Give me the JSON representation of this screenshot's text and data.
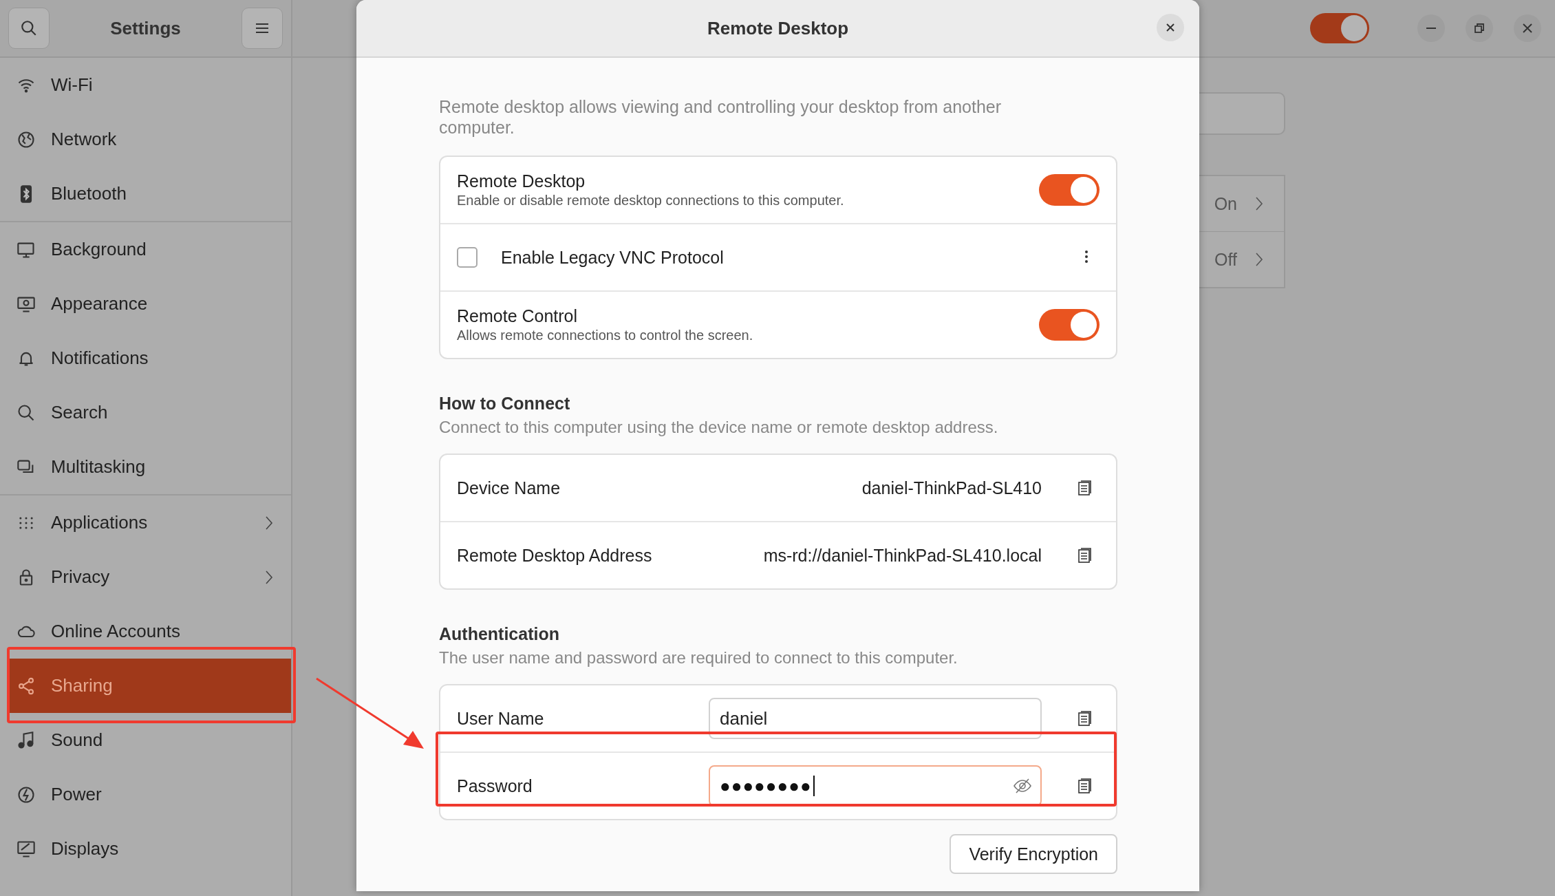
{
  "settings_window": {
    "title": "Settings",
    "sidebar": {
      "groups": [
        [
          {
            "label": "Wi-Fi",
            "selected": false,
            "has_submenu": false
          },
          {
            "label": "Network",
            "selected": false,
            "has_submenu": false
          },
          {
            "label": "Bluetooth",
            "selected": false,
            "has_submenu": false
          }
        ],
        [
          {
            "label": "Background",
            "selected": false,
            "has_submenu": false
          },
          {
            "label": "Appearance",
            "selected": false,
            "has_submenu": false
          },
          {
            "label": "Notifications",
            "selected": false,
            "has_submenu": false
          },
          {
            "label": "Search",
            "selected": false,
            "has_submenu": false
          },
          {
            "label": "Multitasking",
            "selected": false,
            "has_submenu": false
          }
        ],
        [
          {
            "label": "Applications",
            "selected": false,
            "has_submenu": true
          },
          {
            "label": "Privacy",
            "selected": false,
            "has_submenu": true
          },
          {
            "label": "Online Accounts",
            "selected": false,
            "has_submenu": false
          },
          {
            "label": "Sharing",
            "selected": true,
            "has_submenu": false
          },
          {
            "label": "Sound",
            "selected": false,
            "has_submenu": false
          },
          {
            "label": "Power",
            "selected": false,
            "has_submenu": false
          },
          {
            "label": "Displays",
            "selected": false,
            "has_submenu": false
          }
        ]
      ]
    },
    "header_switch": {
      "on": true
    },
    "background_rows": [
      {
        "value": "On"
      },
      {
        "value": "Off"
      }
    ]
  },
  "dialog": {
    "title": "Remote Desktop",
    "intro": "Remote desktop allows viewing and controlling your desktop from another computer.",
    "options": [
      {
        "kind": "switch",
        "title": "Remote Desktop",
        "subtitle": "Enable or disable remote desktop connections to this computer.",
        "on": true
      },
      {
        "kind": "checkbox",
        "title": "Enable Legacy VNC Protocol",
        "checked": false
      },
      {
        "kind": "switch",
        "title": "Remote Control",
        "subtitle": "Allows remote connections to control the screen.",
        "on": true
      }
    ],
    "how_to_connect": {
      "heading": "How to Connect",
      "description": "Connect to this computer using the device name or remote desktop address.",
      "rows": [
        {
          "label": "Device Name",
          "value": "daniel-ThinkPad-SL410"
        },
        {
          "label": "Remote Desktop Address",
          "value": "ms-rd://daniel-ThinkPad-SL410.local"
        }
      ]
    },
    "authentication": {
      "heading": "Authentication",
      "description": "The user name and password are required to connect to this computer.",
      "fields": [
        {
          "kind": "text",
          "label": "User Name",
          "value": "daniel",
          "focused": false
        },
        {
          "kind": "password",
          "label": "Password",
          "value": "●●●●●●●●",
          "focused": true
        }
      ]
    },
    "button": "Verify Encryption"
  }
}
